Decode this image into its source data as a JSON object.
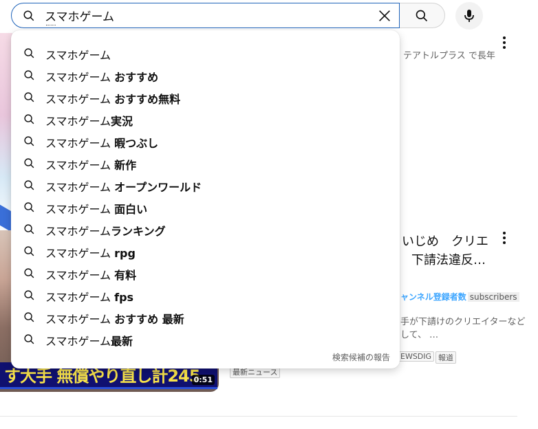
{
  "search": {
    "query": "スマホゲーム",
    "placeholder": "検索"
  },
  "suggestions": [
    {
      "prefix": "スマホゲーム",
      "suffix": ""
    },
    {
      "prefix": "スマホゲーム ",
      "suffix": "おすすめ"
    },
    {
      "prefix": "スマホゲーム ",
      "suffix": "おすすめ無料"
    },
    {
      "prefix": "スマホゲーム",
      "suffix": "実況"
    },
    {
      "prefix": "スマホゲーム ",
      "suffix": "暇つぶし"
    },
    {
      "prefix": "スマホゲーム ",
      "suffix": "新作"
    },
    {
      "prefix": "スマホゲーム ",
      "suffix": "オープンワールド"
    },
    {
      "prefix": "スマホゲーム ",
      "suffix": "面白い"
    },
    {
      "prefix": "スマホゲーム",
      "suffix": "ランキング"
    },
    {
      "prefix": "スマホゲーム ",
      "suffix": "rpg"
    },
    {
      "prefix": "スマホゲーム ",
      "suffix": "有料"
    },
    {
      "prefix": "スマホゲーム ",
      "suffix": "fps"
    },
    {
      "prefix": "スマホゲーム ",
      "suffix": "おすすめ 最新"
    },
    {
      "prefix": "スマホゲーム",
      "suffix": "最新"
    }
  ],
  "report_label": "検索候補の報告",
  "background": {
    "video1_meta": "テアトルプラス で長年",
    "video2_title_line1": "いじめ　クリエ",
    "video2_title_line2": "下請法違反…",
    "video2_channel": "ャンネル登録者数",
    "video2_subscribers": "subscribers",
    "video2_desc_line1": "手が下請けのクリエイターなど",
    "video2_desc_line2": "して、 …",
    "badge_newsdig": "EWSDIG",
    "badge_houdou": "報道",
    "badge_news": "最新ニュース",
    "thumb_banner": "す大手 無償やり直し計245",
    "thumb_duration": "0:51"
  },
  "colors": {
    "focus_border": "#1c62b9",
    "channel_link": "#3ea6ff"
  }
}
